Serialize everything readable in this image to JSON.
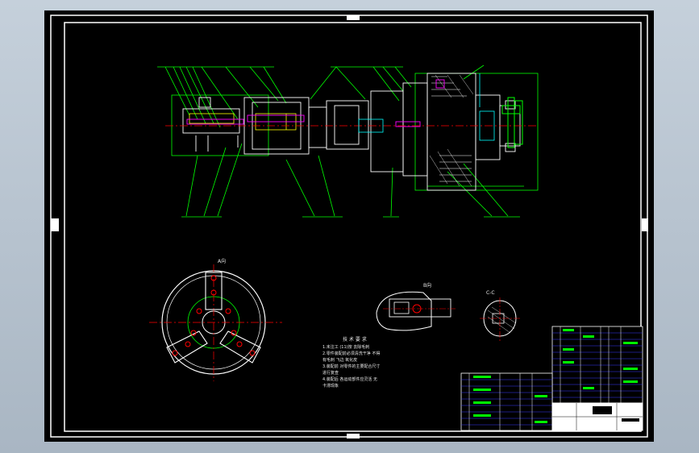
{
  "drawing": {
    "section_labels": [
      "A向",
      "B向",
      "C-C"
    ],
    "tech_notes_title": "技 术 要 求",
    "tech_notes": [
      "1.未注工 (11)按 去除毛刺",
      "2.零件装配前必须清洗干净 不得",
      "  有毛刺 飞边 氧化皮",
      "3.装配前 对零件的主要配合尺寸",
      "  进行复查",
      "4.装配后 各运动部件应灵活 无",
      "  卡滞现象"
    ]
  },
  "colors": {
    "background": "#000000",
    "frame": "#ffffff",
    "lines": "#00ff00",
    "centerlines": "#ff0000",
    "geometry": "#ffffff",
    "hidden": "#ffff00",
    "table": "#0000ff"
  }
}
